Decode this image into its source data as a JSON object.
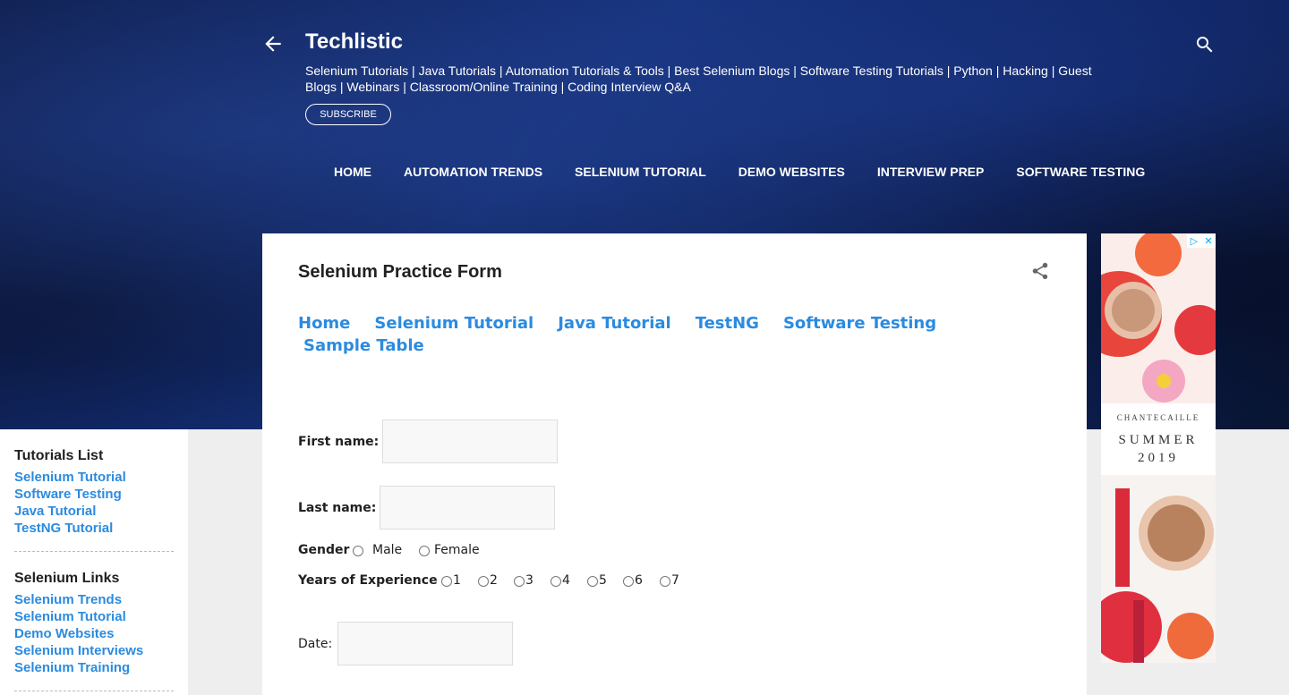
{
  "header": {
    "title": "Techlistic",
    "description": "Selenium Tutorials | Java Tutorials | Automation Tutorials & Tools | Best Selenium Blogs | Software Testing Tutorials | Python | Hacking | Guest Blogs | Webinars | Classroom/Online Training | Coding Interview Q&A",
    "subscribe_label": "SUBSCRIBE"
  },
  "nav": [
    "HOME",
    "AUTOMATION TRENDS",
    "SELENIUM TUTORIAL",
    "DEMO WEBSITES",
    "INTERVIEW PREP",
    "SOFTWARE TESTING"
  ],
  "post": {
    "title": "Selenium Practice Form",
    "links": [
      "Home",
      "Selenium Tutorial",
      "Java Tutorial",
      "TestNG",
      "Software Testing",
      "Sample Table"
    ]
  },
  "form": {
    "first_name_label": "First name:",
    "last_name_label": "Last name:",
    "gender_label": "Gender",
    "gender_options": [
      "Male",
      "Female"
    ],
    "experience_label": "Years of Experience",
    "experience_options": [
      "1",
      "2",
      "3",
      "4",
      "5",
      "6",
      "7"
    ],
    "date_label": "Date:"
  },
  "sidebar": {
    "tutorials_heading": "Tutorials List",
    "tutorials": [
      "Selenium Tutorial",
      "Software Testing",
      "Java Tutorial",
      "TestNG Tutorial"
    ],
    "links_heading": "Selenium Links",
    "links": [
      "Selenium Trends",
      "Selenium Tutorial",
      "Demo Websites",
      "Selenium Interviews",
      "Selenium Training"
    ]
  },
  "ad": {
    "brand": "CHANTECAILLE",
    "headline_1": "SUMMER",
    "headline_2": "2019"
  },
  "colors": {
    "link": "#2b8be0",
    "header_bg": "#14307a"
  }
}
